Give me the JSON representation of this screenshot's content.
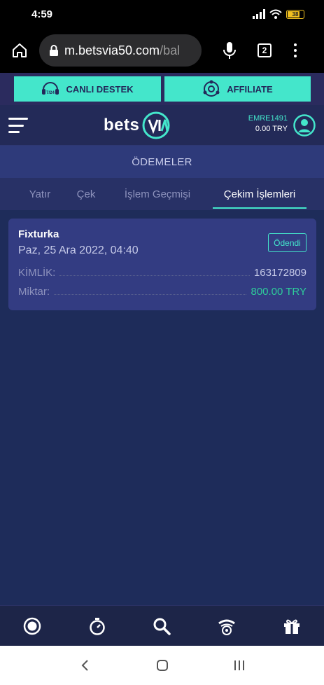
{
  "status": {
    "time": "4:59",
    "battery": "38"
  },
  "browser": {
    "url_main": "m.betsvia50.com",
    "url_path": "/bal",
    "tab_count": "2"
  },
  "promo": {
    "live_support": "CANLI DESTEK",
    "affiliate": "AFFILIATE",
    "live_badge": "7/24"
  },
  "header": {
    "logo_text": "bets",
    "username": "EMRE1491",
    "balance": "0.00 TRY"
  },
  "page_title": "ÖDEMELER",
  "tabs": [
    {
      "label": "Yatır"
    },
    {
      "label": "Çek"
    },
    {
      "label": "İşlem Geçmişi"
    },
    {
      "label": "Çekim İşlemleri"
    }
  ],
  "transaction": {
    "method": "Fixturka",
    "date": "Paz, 25 Ara 2022, 04:40",
    "status": "Ödendi",
    "id_label": "KİMLİK:",
    "id_value": "163172809",
    "amount_label": "Miktar:",
    "amount_value": "800.00 TRY"
  },
  "bottom_nav": [
    {
      "icon": "live-record-icon"
    },
    {
      "icon": "stopwatch-icon"
    },
    {
      "icon": "search-icon"
    },
    {
      "icon": "casino-wheel-icon"
    },
    {
      "icon": "gift-icon"
    }
  ],
  "colors": {
    "accent": "#44e6cb",
    "background": "#1e2c5a",
    "card": "#333c82",
    "paid_green": "#2ecc9a"
  }
}
